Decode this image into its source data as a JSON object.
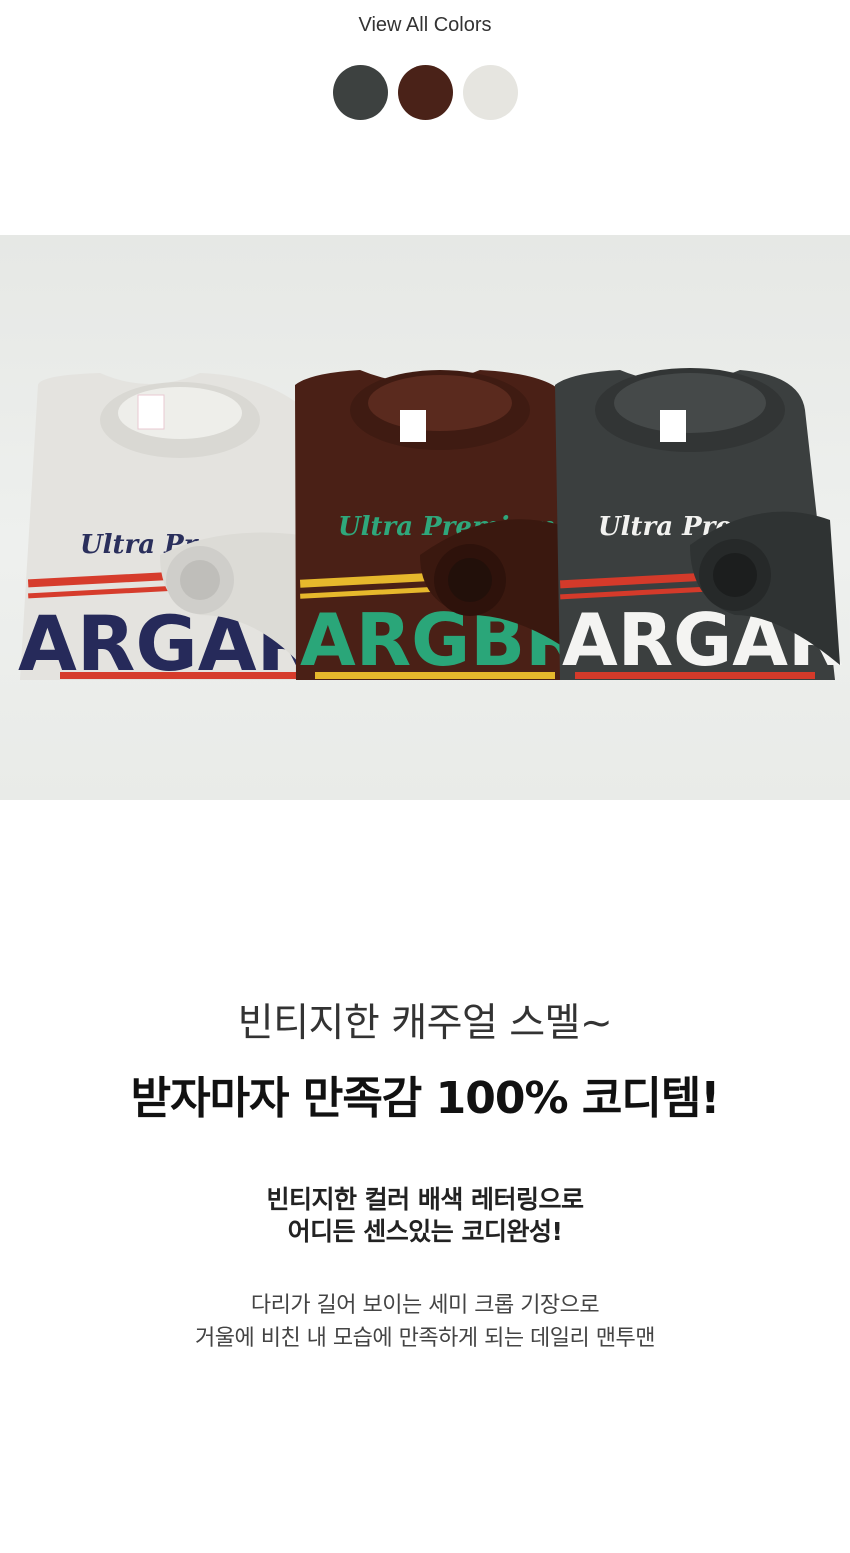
{
  "colors": {
    "title": "View All Colors",
    "swatches": [
      {
        "name": "charcoal",
        "hex": "#3d4140"
      },
      {
        "name": "brown",
        "hex": "#4a2218"
      },
      {
        "name": "ivory",
        "hex": "#e6e5e0"
      }
    ]
  },
  "photo": {
    "sweatshirts": [
      {
        "color": "ivory",
        "body": "#e4e3df",
        "script": "Ultra Premium",
        "script_color": "#2a2f5c",
        "letters": "ARGARI",
        "letter_color": "#262a5a",
        "stripe": "#d63c2c"
      },
      {
        "color": "brown",
        "body": "#4a2016",
        "script": "Ultra Premium",
        "script_color": "#2fa77b",
        "letters": "ARGBRO",
        "letter_color": "#2aa679",
        "stripe": "#e6b82c"
      },
      {
        "color": "charcoal",
        "body": "#3b3f3f",
        "script": "Ultra Premi",
        "script_color": "#f2f2f0",
        "letters": "ARGARI",
        "letter_color": "#f4f4f2",
        "stripe": "#d43a2a"
      }
    ]
  },
  "copy": {
    "headline_light": "빈티지한 캐주얼 스멜~",
    "headline_bold": "받자마자 만족감 100% 코디템!",
    "sub_line1": "빈티지한 컬러 배색 레터링으로",
    "sub_line2": "어디든 센스있는 코디완성!",
    "body_line1": "다리가 길어 보이는 세미 크롭 기장으로",
    "body_line2": "거울에 비친 내 모습에 만족하게 되는 데일리 맨투맨"
  }
}
